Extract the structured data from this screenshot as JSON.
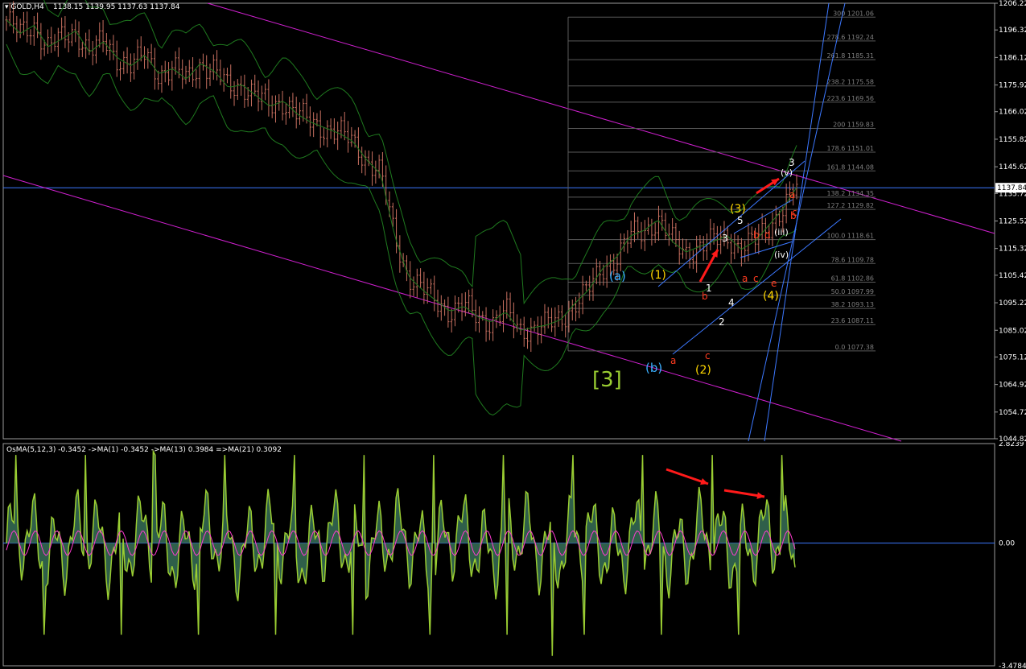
{
  "main_header": {
    "symbol_title": "▾ GOLD,H4",
    "ohlc": "1138.15 1139.95 1137.63 1137.84"
  },
  "osc_header": {
    "text": "OsMA(5,12,3) -0.3452  ->MA(1) -0.3452  ->MA(13) 0.3984  =>MA(21) 0.3092"
  },
  "price_axis": {
    "ticks": [
      "1206.22",
      "1196.32",
      "1186.12",
      "1175.92",
      "1166.02",
      "1155.82",
      "1145.62",
      "1135.72",
      "1125.52",
      "1115.32",
      "1105.42",
      "1095.22",
      "1085.02",
      "1075.12",
      "1064.92",
      "1054.72",
      "1044.82"
    ],
    "current_price": "1137.84"
  },
  "osc_axis": {
    "ticks": [
      "2.8239",
      "0.00",
      "-3.4784"
    ]
  },
  "fib_levels": [
    {
      "ratio": "300",
      "price": "1201.06"
    },
    {
      "ratio": "278.6",
      "price": "1192.24"
    },
    {
      "ratio": "261.8",
      "price": "1185.31"
    },
    {
      "ratio": "238.2",
      "price": "1175.58"
    },
    {
      "ratio": "223.6",
      "price": "1169.56"
    },
    {
      "ratio": "200",
      "price": "1159.83"
    },
    {
      "ratio": "178.6",
      "price": "1151.01"
    },
    {
      "ratio": "161.8",
      "price": "1144.08"
    },
    {
      "ratio": "138.2",
      "price": "1134.35"
    },
    {
      "ratio": "127.2",
      "price": "1129.82"
    },
    {
      "ratio": "100.0",
      "price": "1118.61"
    },
    {
      "ratio": "78.6",
      "price": "1109.78"
    },
    {
      "ratio": "61.8",
      "price": "1102.86"
    },
    {
      "ratio": "50.0",
      "price": "1097.99"
    },
    {
      "ratio": "38.2",
      "price": "1093.13"
    },
    {
      "ratio": "23.6",
      "price": "1087.11"
    },
    {
      "ratio": "0.0",
      "price": "1077.38"
    }
  ],
  "wave_labels": [
    {
      "text": "[3]",
      "color": "#9acd32"
    },
    {
      "text": "(a)",
      "color": "#3ab0ff"
    },
    {
      "text": "(b)",
      "color": "#3ab0ff"
    },
    {
      "text": "(1)",
      "color": "#ffd700"
    },
    {
      "text": "(2)",
      "color": "#ffd700"
    },
    {
      "text": "(3)",
      "color": "#ffd700"
    },
    {
      "text": "(4)",
      "color": "#ffd700"
    },
    {
      "text": "a",
      "color": "#ff3b1f"
    },
    {
      "text": "b",
      "color": "#ff3b1f"
    },
    {
      "text": "c",
      "color": "#ff3b1f"
    },
    {
      "text": "a",
      "color": "#ff3b1f"
    },
    {
      "text": "b",
      "color": "#ff3b1f"
    },
    {
      "text": "c",
      "color": "#ff3b1f"
    },
    {
      "text": "d",
      "color": "#ff3b1f"
    },
    {
      "text": "e",
      "color": "#ff3b1f"
    },
    {
      "text": "a",
      "color": "#ff3b1f"
    },
    {
      "text": "b",
      "color": "#ff3b1f"
    },
    {
      "text": "c",
      "color": "#ff3b1f"
    },
    {
      "text": "1",
      "color": "#ffffff"
    },
    {
      "text": "2",
      "color": "#ffffff"
    },
    {
      "text": "3",
      "color": "#ffffff"
    },
    {
      "text": "4",
      "color": "#ffffff"
    },
    {
      "text": "5",
      "color": "#ffffff"
    },
    {
      "text": "(iii)",
      "color": "#ffffff"
    },
    {
      "text": "(iv)",
      "color": "#ffffff"
    },
    {
      "text": "(v)",
      "color": "#ffffff"
    },
    {
      "text": "3",
      "color": "#ffffff"
    }
  ],
  "chart_data": [
    {
      "type": "candlestick",
      "title": "GOLD,H4",
      "ylim": [
        1044.82,
        1206.22
      ],
      "series_description": "Gold H4 candles with Bollinger bands and Elliott wave labels",
      "close_path": [
        1200,
        1195,
        1198,
        1190,
        1193,
        1196,
        1188,
        1192,
        1186,
        1183,
        1187,
        1180,
        1182,
        1178,
        1184,
        1181,
        1175,
        1176,
        1172,
        1168,
        1170,
        1165,
        1162,
        1160,
        1158,
        1155,
        1148,
        1143,
        1120,
        1105,
        1100,
        1096,
        1092,
        1094,
        1090,
        1088,
        1092,
        1085,
        1086,
        1087,
        1089,
        1095,
        1100,
        1108,
        1112,
        1120,
        1122,
        1126,
        1118,
        1114,
        1116,
        1118,
        1120,
        1115,
        1118,
        1124,
        1130,
        1138
      ],
      "colors": {
        "bull": "#c87060",
        "bear": "#c87060",
        "bands": "#1f7a1f",
        "channel": "#d020d0",
        "trend": "#3c78ff",
        "fib": "#5a5a5a",
        "fib_text": "#7f7f7f",
        "arrows": "#ff1a1a",
        "hline": "#3c78ff"
      }
    },
    {
      "type": "histogram",
      "title": "OsMA(5,12,3)",
      "ylim": [
        -3.4784,
        2.8239
      ],
      "values_summary": {
        "last": -0.3452,
        "ma1": -0.3452,
        "ma13": 0.3984,
        "ma21": 0.3092
      },
      "colors": {
        "line": "#9acd32",
        "fill": "#2f5f4a",
        "signal": "#ff3bd0",
        "zero": "#3c78ff"
      }
    }
  ]
}
